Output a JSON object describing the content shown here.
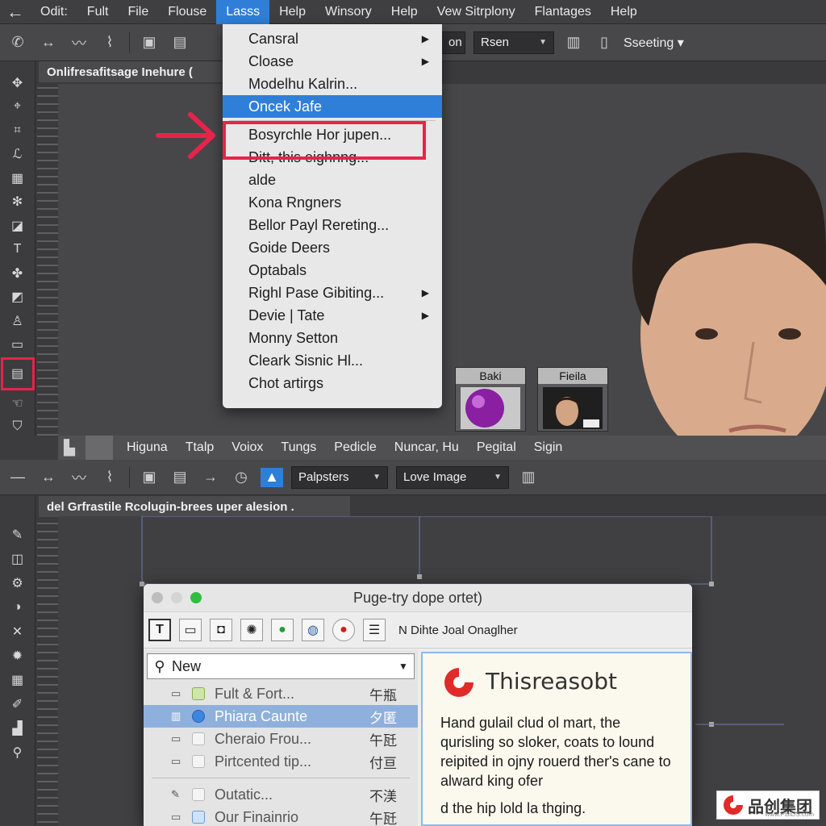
{
  "menubar": {
    "items": [
      "Odit:",
      "Fult",
      "File",
      "Flouse",
      "Lasss",
      "Help",
      "Winsory",
      "Help",
      "Vew Sitrplony",
      "Flantages",
      "Help"
    ],
    "active_index": 4
  },
  "toolbar_top": {
    "dropdown_on": "on",
    "dropdown_rsen": "Rsen",
    "right_label": "Sseeting"
  },
  "doc_tab_top": "Onlifresafitsage Inehure (",
  "dropdown_menu": {
    "items": [
      {
        "label": "Cansral",
        "submenu": true
      },
      {
        "label": "Cloase",
        "submenu": true
      },
      {
        "label": "Modelhu Kalrin...",
        "submenu": false
      },
      {
        "label": "Oncek Jafe",
        "submenu": false,
        "selected": true
      },
      {
        "label": "Bosyrchle Hor jupen...",
        "submenu": false,
        "highlighted": true
      },
      {
        "label": "Ditt, this eighnng...",
        "submenu": false
      },
      {
        "label": "alde",
        "submenu": false
      },
      {
        "label": "Kona Rngners",
        "submenu": false
      },
      {
        "label": "Bellor Payl Rereting...",
        "submenu": false
      },
      {
        "label": "Goide Deers",
        "submenu": false
      },
      {
        "label": "Optabals",
        "submenu": false
      },
      {
        "label": "Righl Pase Gibiting...",
        "submenu": true
      },
      {
        "label": "Devie | Tate",
        "submenu": true
      },
      {
        "label": "Monny Setton",
        "submenu": false
      },
      {
        "label": "Cleark Sisnic Hl...",
        "submenu": false
      },
      {
        "label": "Chot artirgs",
        "submenu": false
      }
    ]
  },
  "thumbnails": [
    {
      "label": "Baki"
    },
    {
      "label": "Fieila"
    }
  ],
  "midbar": {
    "items": [
      "Higuna",
      "Ttalp",
      "Voiox",
      "Tungs",
      "Pedicle",
      "Nuncar, Hu",
      "Pegital",
      "Sigin"
    ]
  },
  "toolbar_bottom": {
    "dropdown_1": "Palpsters",
    "dropdown_2": "Love Image"
  },
  "doc_tab_bottom": "del Grfrastile Rcolugin-brees uper alesion .",
  "dialog": {
    "title": "Puge-try dope ortet)",
    "toolbar_text": "N Dihte Joal Onaglher",
    "search_value": "New",
    "list": [
      {
        "label": "Fult & Fort...",
        "cjk": "午瓶",
        "selected": false
      },
      {
        "label": "Phiara Caunte",
        "cjk": "夕匿",
        "selected": true
      },
      {
        "label": "Cheraio Frou...",
        "cjk": "午瓩",
        "selected": false
      },
      {
        "label": "Pirtcented tip...",
        "cjk": "付亘",
        "selected": false
      },
      {
        "label": "Outatic...",
        "cjk": "不渼",
        "selected": false
      },
      {
        "label": "Our Finainrio",
        "cjk": "午瓩",
        "selected": false
      }
    ],
    "preview": {
      "brand": "Thisreasobt",
      "para1": "Hand gulail clud ol mart, the qurisling so sloker, coats to lound reipited in ojny rouerd ther's cane to alward king ofer",
      "para2": "d the hip lold la thging."
    }
  },
  "watermark": {
    "brand": "品创集团",
    "url": "www.PBIDS.com"
  },
  "colors": {
    "accent": "#2f7fd8",
    "highlight_red": "#e8234a"
  }
}
